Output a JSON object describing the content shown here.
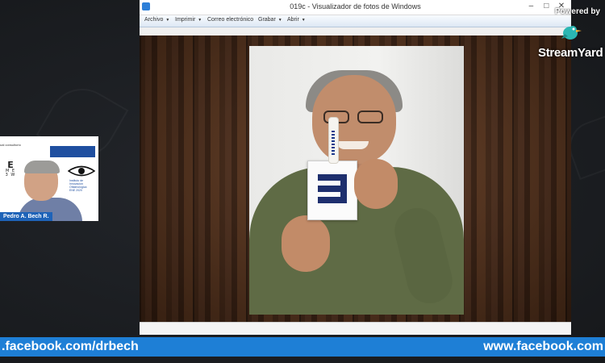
{
  "viewer": {
    "title": "019c - Visualizador de fotos de Windows",
    "controls": [
      "–",
      "□",
      "✕"
    ],
    "menu": [
      {
        "label": "Archivo",
        "has_caret": true
      },
      {
        "label": "Imprimir",
        "has_caret": true
      },
      {
        "label": "Correo electrónico",
        "has_caret": false
      },
      {
        "label": "Grabar",
        "has_caret": true
      },
      {
        "label": "Abrir",
        "has_caret": true
      }
    ]
  },
  "streamyard": {
    "powered_by": "Powered by",
    "brand": "StreamYard"
  },
  "webcam": {
    "name_label": "Pedro A. Bech R.",
    "top_text": "ual consultorio",
    "eyechart": [
      "E",
      "M E",
      "3 W"
    ],
    "institute": [
      "Instituto de",
      "Innovación Oftalmológica",
      "ENE 2020"
    ]
  },
  "banner": {
    "left_text": ".facebook.com/drbech",
    "right_text": "www.facebook.com"
  },
  "colors": {
    "banner": "#1e7fd6",
    "name_tag": "#1e63b8",
    "chart_symbol": "#1e2f6e"
  },
  "icons": {
    "photo_viewer": "photo-viewer-icon",
    "streamyard": "bird-logo-icon",
    "eye": "eye-icon"
  }
}
